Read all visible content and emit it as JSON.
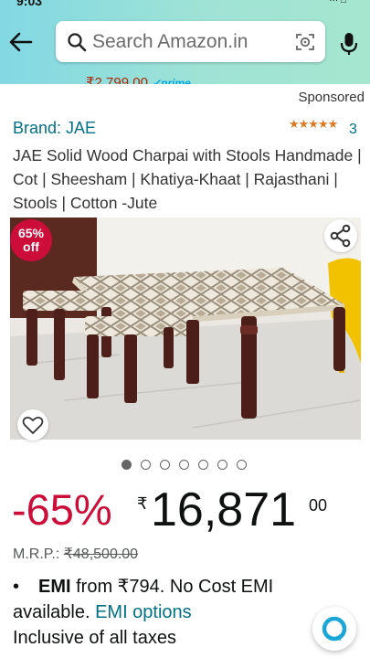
{
  "status_bar": {
    "time": "9:03",
    "icons": "··· □"
  },
  "search": {
    "placeholder": "Search Amazon.in"
  },
  "promo_strip": {
    "price": "₹2,799.00",
    "prime": "✓prime"
  },
  "sponsored_label": "Sponsored",
  "product": {
    "brand": "Brand: JAE",
    "rating_stars": "★★★★★",
    "rating_value": 4.5,
    "rating_count": "3",
    "title": "JAE Solid Wood Charpai with Stools Handmade | Cot | Sheesham | Khatiya-Khaat | Rajasthani | Stools | Cotton -Jute",
    "discount_badge": {
      "pct": "65%",
      "word": "off"
    },
    "image_dots": 7,
    "active_dot": 0,
    "discount": "-65%",
    "currency": "₹",
    "price_whole": "16,871",
    "price_fraction": "00",
    "mrp_label": "M.R.P.: ",
    "mrp_value": "₹48,500.00",
    "emi": {
      "bullet": "•",
      "bold": "EMI",
      "text": " from ₹794. No Cost EMI available. ",
      "link": "EMI options"
    },
    "taxes": "Inclusive of all taxes"
  },
  "icons": {
    "back": "arrow-left-icon",
    "search": "search-icon",
    "lens": "camera-lens-icon",
    "mic": "microphone-icon",
    "share": "share-icon",
    "wishlist": "heart-icon",
    "assistant": "assistant-icon"
  },
  "colors": {
    "header_gradient_start": "#82d8e3",
    "header_gradient_end": "#a6e6cf",
    "discount_red": "#cc0c39",
    "link_teal": "#007185",
    "star_orange": "#de7921"
  }
}
